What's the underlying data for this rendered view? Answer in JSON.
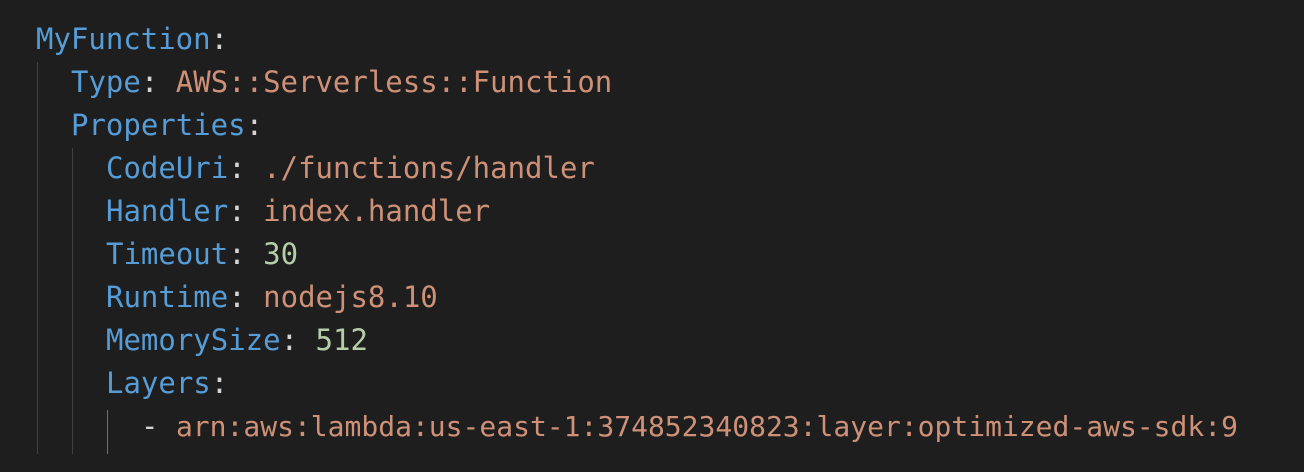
{
  "root": {
    "key": "MyFunction",
    "colon": ":"
  },
  "type": {
    "key": "Type",
    "colon": ":",
    "value": "AWS::Serverless::Function"
  },
  "properties": {
    "key": "Properties",
    "colon": ":"
  },
  "codeuri": {
    "key": "CodeUri",
    "colon": ":",
    "value": "./functions/handler"
  },
  "handler": {
    "key": "Handler",
    "colon": ":",
    "value": "index.handler"
  },
  "timeout": {
    "key": "Timeout",
    "colon": ":",
    "value": "30"
  },
  "runtime": {
    "key": "Runtime",
    "colon": ":",
    "value": "nodejs8.10"
  },
  "memorysize": {
    "key": "MemorySize",
    "colon": ":",
    "value": "512"
  },
  "layers": {
    "key": "Layers",
    "colon": ":"
  },
  "layer_item": {
    "dash": "-",
    "value": "arn:aws:lambda:us-east-1:374852340823:layer:optimized-aws-sdk:9"
  },
  "colors": {
    "background": "#1e1e1e",
    "key": "#569cd6",
    "string": "#ce9178",
    "number": "#b5cea8",
    "punctuation": "#d4d4d4",
    "indent_guide": "#404040"
  }
}
